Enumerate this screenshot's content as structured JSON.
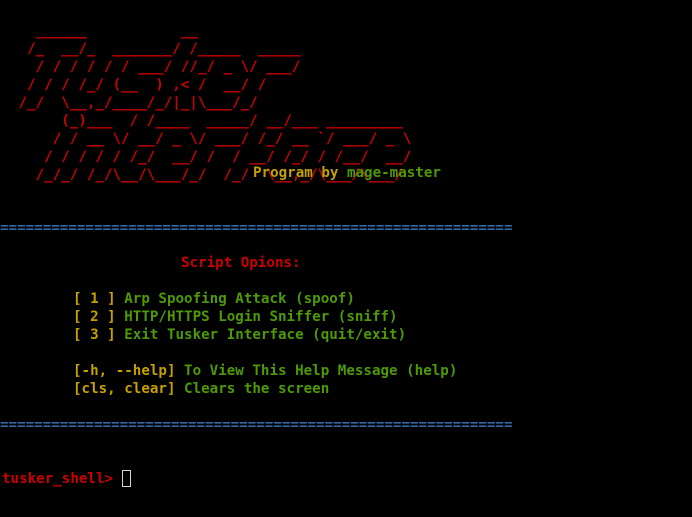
{
  "banner": {
    "art": "   ______           __\n  /_  __/_  _______/ /_____  _____\n   / / / / / / ___/ //_/ _ \\/ ___/\n  / / / /_/ (__  ) ,< /  __/ /\n /_/  \\__,_/____/_/|_|\\___/_/\n      (_)___  / /____  _____/ __/___ _________\n     / / __ \\/ __/ _ \\/ ___/ /_/ __ `/ ___/ _ \\\n    / / / / / /_/  __/ /  / __/ /_/ / /__/  __/\n   /_/_/ /_/\\__/\\___/_/  /_/  \\__,_/\\___/\\___/"
  },
  "credits": {
    "prefix": "Program by",
    "author": "mage-master"
  },
  "separator": "============================================================",
  "menu": {
    "title": "Script Opions:",
    "options": [
      {
        "key": "[ 1 ]",
        "label": "Arp Spoofing Attack (spoof)"
      },
      {
        "key": "[ 2 ]",
        "label": "HTTP/HTTPS Login Sniffer (sniff)"
      },
      {
        "key": "[ 3 ]",
        "label": "Exit Tusker Interface (quit/exit)"
      }
    ],
    "help": [
      {
        "key": "[-h, --help]",
        "label": "To View This Help Message (help)"
      },
      {
        "key": "[cls, clear]",
        "label": "Clears the screen"
      }
    ]
  },
  "prompt": {
    "text": "tusker_shell>",
    "input_value": ""
  },
  "colors": {
    "background": "#000000",
    "red": "#cc0000",
    "yellow": "#c4a000",
    "green": "#4e9a06",
    "blue": "#3465a4"
  }
}
